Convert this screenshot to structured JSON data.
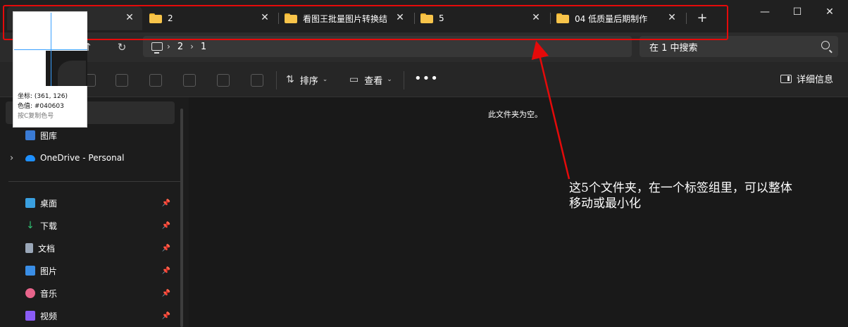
{
  "tabs": [
    {
      "label": "",
      "close": "✕"
    },
    {
      "label": "2",
      "close": "✕"
    },
    {
      "label": "看图王批量图片转换结",
      "close": "✕"
    },
    {
      "label": "5",
      "close": "✕"
    },
    {
      "label": "04 低质量后期制作",
      "close": "✕"
    }
  ],
  "new_tab": "+",
  "window": {
    "minimize": "—",
    "maximize": "☐",
    "close": "✕"
  },
  "nav": {
    "forward": "→",
    "up": "↑",
    "refresh": "↻"
  },
  "breadcrumb": [
    "2",
    "1"
  ],
  "breadcrumb_sep": "›",
  "search": {
    "placeholder": "在 1 中搜索"
  },
  "commands": {
    "sort_label": "排序",
    "sort_glyph": "⇅",
    "view_label": "查看",
    "view_glyph": "▭",
    "caret": "⌄",
    "more": "•••",
    "details_label": "详细信息"
  },
  "sidebar": {
    "items": [
      {
        "label": "图库",
        "icon": "gallery-icon",
        "color": "#3a7bd5"
      },
      {
        "label": "OneDrive - Personal",
        "icon": "cloud-icon",
        "color": "#1e90ff",
        "expand": "›"
      },
      {
        "label": "桌面",
        "icon": "desktop-icon",
        "color": "#3aa0e0",
        "pin": "📌"
      },
      {
        "label": "下载",
        "icon": "download-icon",
        "color": "#2fbf71",
        "pin": "📌"
      },
      {
        "label": "文档",
        "icon": "documents-icon",
        "color": "#9aa7b8",
        "pin": "📌"
      },
      {
        "label": "图片",
        "icon": "pictures-icon",
        "color": "#3a8ee6",
        "pin": "📌"
      },
      {
        "label": "音乐",
        "icon": "music-icon",
        "color": "#e8648b",
        "pin": "📌"
      },
      {
        "label": "视频",
        "icon": "videos-icon",
        "color": "#8a5cf6",
        "pin": "📌"
      }
    ]
  },
  "content": {
    "empty_message": "此文件夹为空。"
  },
  "magnifier": {
    "coords": "坐标: (361, 126)",
    "color": "色值: #040603",
    "hint": "按C复制色号"
  },
  "annotation": "这5个文件夹，在一个标签组里，可以整体移动或最小化",
  "colors": {
    "annotation_red": "#e50a0a",
    "folder_yellow": "#f8c44a",
    "background": "#1c1c1c"
  }
}
